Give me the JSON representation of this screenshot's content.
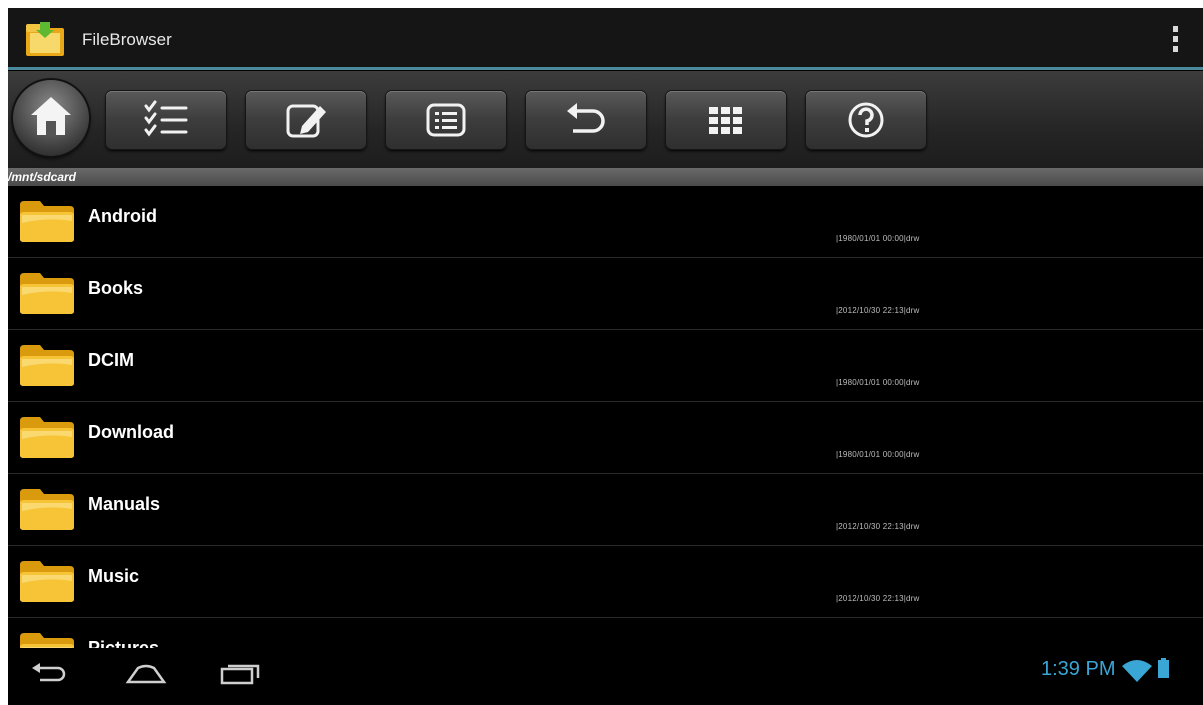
{
  "app": {
    "title": "FileBrowser",
    "icon": "folder-app-icon",
    "overflow_icon": "overflow-menu-icon"
  },
  "toolbar": {
    "buttons": [
      {
        "name": "home",
        "icon": "home-icon"
      },
      {
        "name": "multi-select",
        "icon": "checklist-icon"
      },
      {
        "name": "edit",
        "icon": "edit-icon"
      },
      {
        "name": "list-view",
        "icon": "list-icon"
      },
      {
        "name": "back",
        "icon": "undo-arrow-icon"
      },
      {
        "name": "grid-view",
        "icon": "grid-icon"
      },
      {
        "name": "help",
        "icon": "help-icon"
      }
    ]
  },
  "path": "/mnt/sdcard",
  "files": [
    {
      "name": "Android",
      "meta": "|1980/01/01 00:00|drw"
    },
    {
      "name": "Books",
      "meta": "|2012/10/30 22:13|drw"
    },
    {
      "name": "DCIM",
      "meta": "|1980/01/01 00:00|drw"
    },
    {
      "name": "Download",
      "meta": "|1980/01/01 00:00|drw"
    },
    {
      "name": "Manuals",
      "meta": "|2012/10/30 22:13|drw"
    },
    {
      "name": "Music",
      "meta": "|2012/10/30 22:13|drw"
    },
    {
      "name": "Pictures",
      "meta": ""
    }
  ],
  "status": {
    "time": "1:39 PM",
    "wifi_icon": "wifi-icon",
    "battery_icon": "battery-icon",
    "accent_color": "#3aa6d6"
  },
  "nav": {
    "buttons": [
      "back-nav-icon",
      "home-nav-icon",
      "recents-nav-icon"
    ]
  }
}
